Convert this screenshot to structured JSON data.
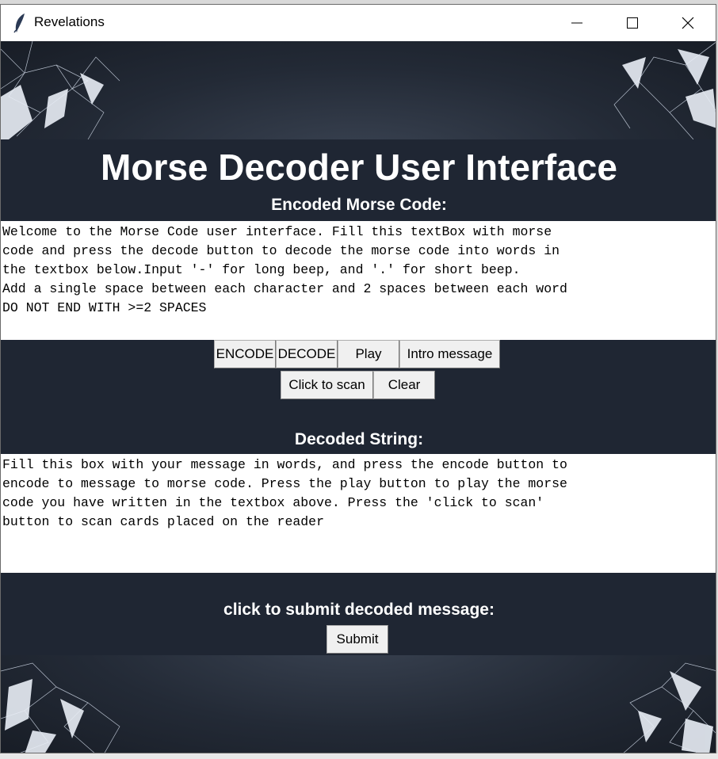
{
  "window": {
    "title": "Revelations",
    "controls": {
      "minimize": "minimize-icon",
      "maximize": "maximize-icon",
      "close": "close-icon"
    }
  },
  "main": {
    "heading": "Morse Decoder User Interface",
    "encoded_label": "Encoded Morse Code:",
    "encoded_text": "Welcome to the Morse Code user interface. Fill this textBox with morse\ncode and press the decode button to decode the morse code into words in\nthe textbox below.Input '-' for long beep, and '.' for short beep.\nAdd a single space between each character and 2 spaces between each word\nDO NOT END WITH >=2 SPACES",
    "buttons": {
      "encode": "ENCODE",
      "decode": "DECODE",
      "play": "Play",
      "intro": "Intro message",
      "scan": "Click to scan",
      "clear": "Clear"
    },
    "decoded_label": "Decoded String:",
    "decoded_text": "Fill this box with your message in words, and press the encode button to\nencode to message to morse code. Press the play button to play the morse\ncode you have written in the textbox above. Press the 'click to scan'\nbutton to scan cards placed on the reader",
    "submit_label": "click to submit decoded message:",
    "submit_button": "Submit"
  },
  "colors": {
    "panel": "#1f2633",
    "text_light": "#ffffff",
    "textbox": "#ffffff",
    "button": "#f0f0f0"
  }
}
